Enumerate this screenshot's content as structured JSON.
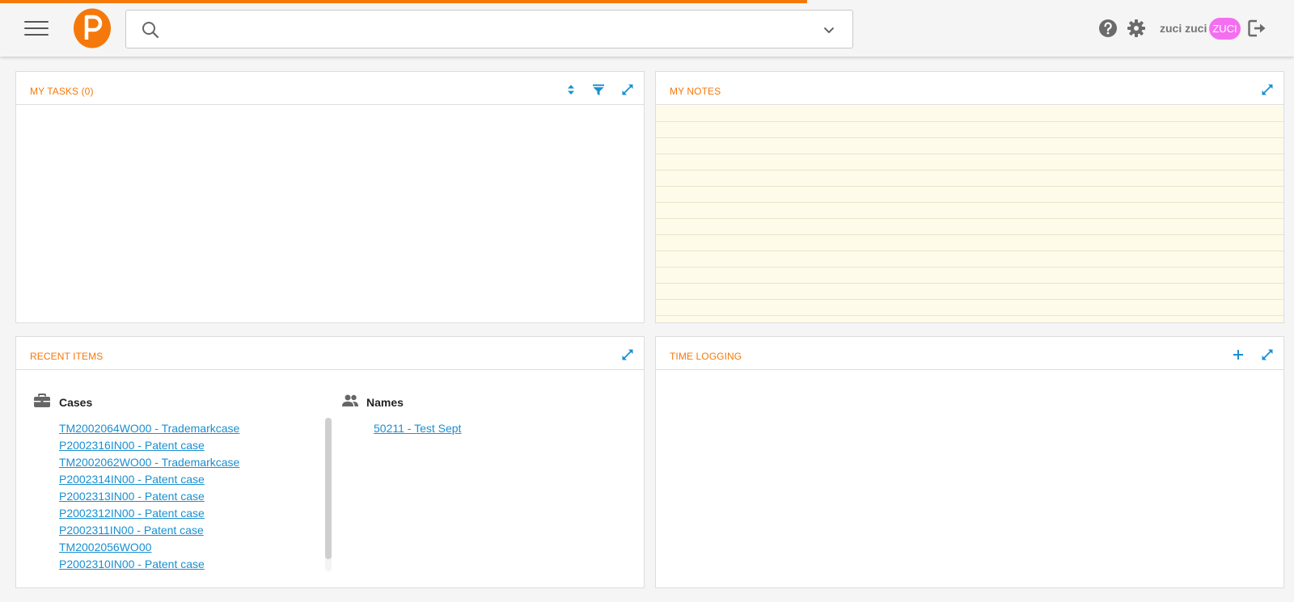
{
  "colors": {
    "accent": "#f5780a",
    "link": "#1a8fd1",
    "avatar": "#f46ff0",
    "notes_bg": "#fffbea"
  },
  "header": {
    "search_placeholder": "",
    "user_name": "zuci zuci",
    "avatar_text": "ZUCI"
  },
  "panels": {
    "tasks": {
      "title": "MY TASKS (0)"
    },
    "notes": {
      "title": "MY NOTES"
    },
    "recent": {
      "title": "RECENT ITEMS",
      "cases_title": "Cases",
      "names_title": "Names",
      "cases": [
        "TM2002064WO00 - Trademarkcase",
        "P2002316IN00 - Patent case",
        "TM2002062WO00 - Trademarkcase",
        "P2002314IN00 - Patent case",
        "P2002313IN00 - Patent case",
        "P2002312IN00 - Patent case",
        "P2002311IN00 - Patent case",
        "TM2002056WO00",
        "P2002310IN00 - Patent case"
      ],
      "names": [
        "50211 - Test Sept"
      ]
    },
    "time": {
      "title": "TIME LOGGING"
    }
  },
  "icons": [
    "menu-icon",
    "logo-icon",
    "search-icon",
    "chevron-down-icon",
    "help-icon",
    "gear-icon",
    "logout-icon",
    "sort-icon",
    "filter-icon",
    "expand-icon",
    "plus-icon",
    "briefcase-icon",
    "people-icon"
  ]
}
